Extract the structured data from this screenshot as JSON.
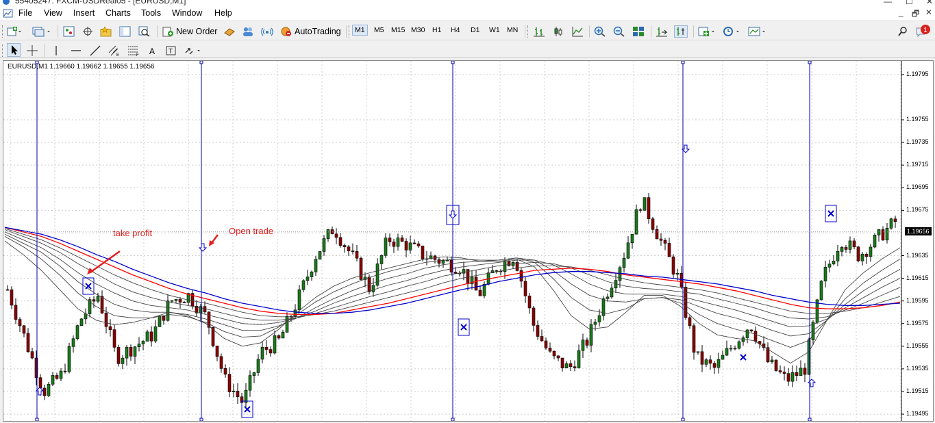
{
  "window": {
    "title": "55405247: FXCM-USDReal05 - [EURUSD,M1]"
  },
  "menu": [
    "File",
    "View",
    "Insert",
    "Charts",
    "Tools",
    "Window",
    "Help"
  ],
  "toolbar": {
    "new_order": "New Order",
    "autotrading": "AutoTrading",
    "timeframes": [
      "M1",
      "M5",
      "M15",
      "M30",
      "H1",
      "H4",
      "D1",
      "W1",
      "MN"
    ],
    "active_timeframe": "M1",
    "notifications": "1"
  },
  "chart": {
    "symbol_info": "EURUSD,M1  1.19660 1.19662 1.19655 1.19656",
    "current_price": "1.19656",
    "price_labels": [
      "1.19795",
      "1.19755",
      "1.19735",
      "1.19715",
      "1.19695",
      "1.19675",
      "1.19635",
      "1.19615",
      "1.19595",
      "1.19575",
      "1.19555",
      "1.19535",
      "1.19515",
      "1.19495"
    ],
    "annotations": {
      "take_profit": "take profit",
      "open_trade": "Open trade"
    },
    "colors": {
      "bull_candle": "#1a7a1a",
      "bear_candle": "#8b0000",
      "ema_fast": "#ff0000",
      "ema_slow": "#0000cc",
      "vline": "#0000aa"
    }
  },
  "chart_data": {
    "type": "line",
    "ylim": [
      1.19489,
      1.19807
    ],
    "ticks": [
      1.19795,
      1.19755,
      1.19735,
      1.19715,
      1.19695,
      1.19675,
      1.19655,
      1.19635,
      1.19615,
      1.19595,
      1.19575,
      1.19555,
      1.19535,
      1.19515,
      1.19495
    ],
    "series": [
      {
        "name": "",
        "values": [
          1.19605,
          1.1956,
          1.19515,
          1.1953,
          1.19578,
          1.196,
          1.19545,
          1.19555,
          1.19565,
          1.19595,
          1.196,
          1.1958,
          1.19525,
          1.19505,
          1.1955,
          1.1956,
          1.19595,
          1.19635,
          1.1966,
          1.19635,
          1.19605,
          1.1965,
          1.19645,
          1.19635,
          1.1963,
          1.19625,
          1.196,
          1.19625,
          1.19635,
          1.19575,
          1.19545,
          1.19535,
          1.1956,
          1.196,
          1.19635,
          1.19685,
          1.1965,
          1.19615,
          1.19545,
          1.19535,
          1.19555,
          1.19575,
          1.1954,
          1.19525,
          1.19535,
          1.19615,
          1.1965,
          1.19635,
          1.1965,
          1.19665
        ]
      },
      {
        "name": "",
        "values": [
          1.19648,
          1.19636,
          1.19622,
          1.19605,
          1.19588,
          1.19578,
          1.19574,
          1.19576,
          1.1958,
          1.19585,
          1.19582,
          1.19575,
          1.19562,
          1.19555,
          1.19558,
          1.1957,
          1.19585,
          1.19598,
          1.19608,
          1.19615,
          1.1962,
          1.19624,
          1.19628,
          1.19632,
          1.19634,
          1.19633,
          1.1963,
          1.1963,
          1.19632,
          1.19625,
          1.19605,
          1.19582,
          1.1957,
          1.19572,
          1.19585,
          1.196,
          1.196,
          1.1959,
          1.19575,
          1.19565,
          1.19562,
          1.1956,
          1.1955,
          1.1954,
          1.1955,
          1.19578,
          1.19605,
          1.1962,
          1.19632,
          1.19642
        ]
      },
      {
        "name": "",
        "values": [
          1.19652,
          1.19643,
          1.19632,
          1.19618,
          1.19602,
          1.1959,
          1.19582,
          1.1958,
          1.1958,
          1.19583,
          1.19581,
          1.19576,
          1.19568,
          1.19563,
          1.19564,
          1.19572,
          1.19583,
          1.19594,
          1.19603,
          1.1961,
          1.19616,
          1.19621,
          1.19625,
          1.19629,
          1.19631,
          1.19632,
          1.19631,
          1.19631,
          1.19633,
          1.19629,
          1.19615,
          1.19598,
          1.19587,
          1.19584,
          1.19588,
          1.19597,
          1.19598,
          1.19593,
          1.19583,
          1.19575,
          1.1957,
          1.19566,
          1.1956,
          1.19554,
          1.1956,
          1.19578,
          1.19597,
          1.19611,
          1.19622,
          1.19632
        ]
      },
      {
        "name": "",
        "values": [
          1.19654,
          1.19646,
          1.19638,
          1.19626,
          1.19612,
          1.19601,
          1.19592,
          1.19587,
          1.19585,
          1.19585,
          1.19583,
          1.19579,
          1.19574,
          1.19569,
          1.19569,
          1.19573,
          1.1958,
          1.19589,
          1.19597,
          1.19604,
          1.1961,
          1.19615,
          1.19619,
          1.19624,
          1.19627,
          1.19629,
          1.1963,
          1.19631,
          1.19633,
          1.19631,
          1.19622,
          1.1961,
          1.196,
          1.19595,
          1.19594,
          1.19597,
          1.19598,
          1.19596,
          1.1959,
          1.19584,
          1.1958,
          1.19575,
          1.19569,
          1.19564,
          1.19566,
          1.19578,
          1.19592,
          1.19604,
          1.19614,
          1.19623
        ]
      },
      {
        "name": "",
        "values": [
          1.19656,
          1.19649,
          1.19642,
          1.19632,
          1.1962,
          1.1961,
          1.19602,
          1.19595,
          1.19591,
          1.19589,
          1.19587,
          1.19583,
          1.19579,
          1.19575,
          1.19574,
          1.19576,
          1.1958,
          1.19586,
          1.19593,
          1.19599,
          1.19604,
          1.19609,
          1.19613,
          1.19618,
          1.19622,
          1.19625,
          1.19627,
          1.19629,
          1.19631,
          1.19631,
          1.19627,
          1.19619,
          1.1961,
          1.19604,
          1.19601,
          1.19601,
          1.19601,
          1.19599,
          1.19595,
          1.19591,
          1.19587,
          1.19582,
          1.19577,
          1.19572,
          1.19573,
          1.19579,
          1.19589,
          1.19598,
          1.19607,
          1.19615
        ]
      },
      {
        "name": "",
        "values": [
          1.19658,
          1.19652,
          1.19646,
          1.19638,
          1.19628,
          1.19619,
          1.1961,
          1.19603,
          1.19598,
          1.19594,
          1.19591,
          1.19588,
          1.19584,
          1.1958,
          1.19578,
          1.19578,
          1.1958,
          1.19584,
          1.19589,
          1.19594,
          1.19599,
          1.19603,
          1.19608,
          1.19612,
          1.19617,
          1.1962,
          1.19623,
          1.19626,
          1.19628,
          1.19629,
          1.19628,
          1.19624,
          1.19618,
          1.19612,
          1.19608,
          1.19606,
          1.19605,
          1.19603,
          1.19601,
          1.19597,
          1.19593,
          1.19589,
          1.19584,
          1.1958,
          1.19579,
          1.19581,
          1.19587,
          1.19593,
          1.196,
          1.19607
        ]
      },
      {
        "name": "",
        "values": [
          1.19659,
          1.19654,
          1.19649,
          1.19642,
          1.19634,
          1.19626,
          1.19618,
          1.19611,
          1.19605,
          1.196,
          1.19596,
          1.19593,
          1.19589,
          1.19585,
          1.19582,
          1.19581,
          1.19581,
          1.19583,
          1.19586,
          1.1959,
          1.19594,
          1.19598,
          1.19602,
          1.19606,
          1.19611,
          1.19615,
          1.19618,
          1.19621,
          1.19624,
          1.19626,
          1.19626,
          1.19625,
          1.19622,
          1.19618,
          1.19614,
          1.19611,
          1.19609,
          1.19607,
          1.19605,
          1.19602,
          1.19598,
          1.19594,
          1.1959,
          1.19586,
          1.19584,
          1.19584,
          1.19586,
          1.19589,
          1.19594,
          1.19599
        ]
      },
      {
        "name": "",
        "values": [
          1.1966,
          1.19656,
          1.19652,
          1.19646,
          1.19639,
          1.19632,
          1.19625,
          1.19618,
          1.19612,
          1.19606,
          1.19601,
          1.19597,
          1.19593,
          1.19589,
          1.19586,
          1.19584,
          1.19583,
          1.19583,
          1.19584,
          1.19587,
          1.1959,
          1.19593,
          1.19597,
          1.19601,
          1.19605,
          1.19609,
          1.19613,
          1.19616,
          1.19619,
          1.19622,
          1.19623,
          1.19624,
          1.19623,
          1.19621,
          1.19618,
          1.19616,
          1.19614,
          1.19612,
          1.1961,
          1.19607,
          1.19604,
          1.196,
          1.19596,
          1.19592,
          1.19589,
          1.19588,
          1.19588,
          1.19589,
          1.19591,
          1.19594
        ]
      },
      {
        "name": "",
        "values": [
          1.1966,
          1.19657,
          1.19654,
          1.19649,
          1.19643,
          1.19636,
          1.1963,
          1.19623,
          1.19617,
          1.19611,
          1.19606,
          1.19602,
          1.19597,
          1.19593,
          1.1959,
          1.19587,
          1.19585,
          1.19584,
          1.19584,
          1.19585,
          1.19587,
          1.1959,
          1.19593,
          1.19597,
          1.19601,
          1.19605,
          1.19608,
          1.19612,
          1.19615,
          1.19618,
          1.1962,
          1.19621,
          1.19621,
          1.1962,
          1.19619,
          1.19617,
          1.19616,
          1.19614,
          1.19612,
          1.1961,
          1.19607,
          1.19604,
          1.196,
          1.19597,
          1.19594,
          1.19592,
          1.19591,
          1.19591,
          1.19592,
          1.19593
        ]
      }
    ]
  }
}
